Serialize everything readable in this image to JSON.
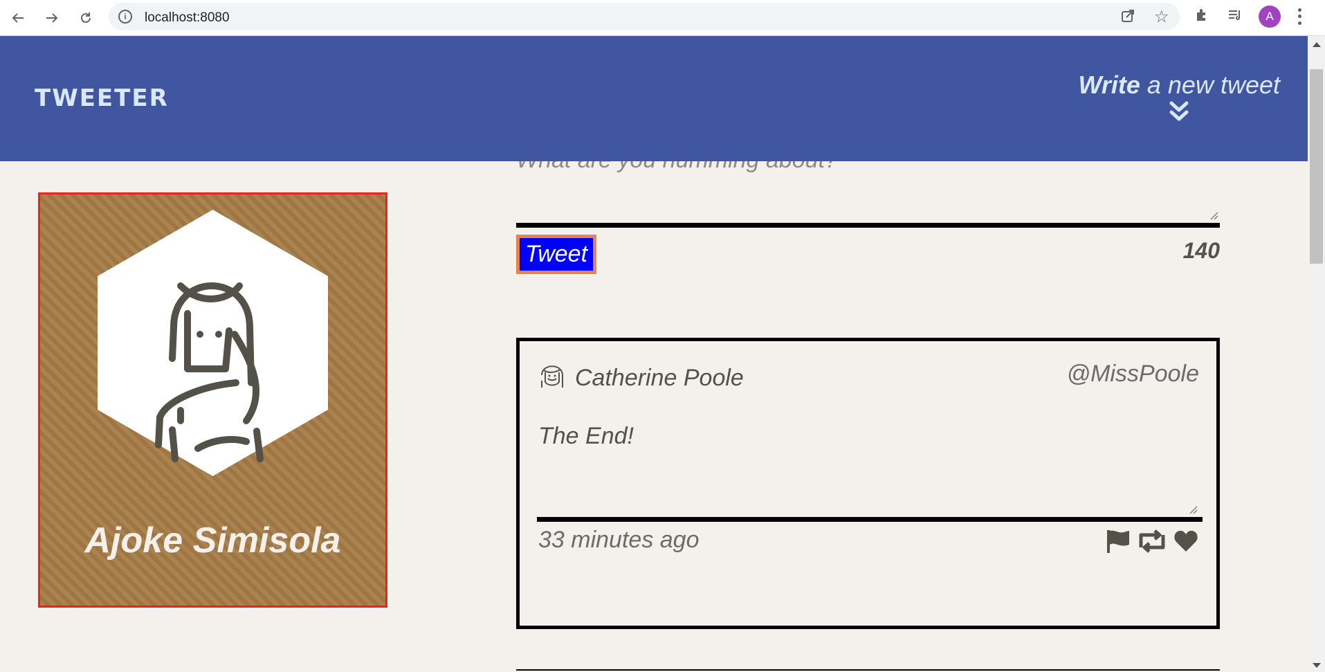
{
  "browser": {
    "url": "localhost:8080",
    "profile_initial": "A"
  },
  "header": {
    "brand": "TWEETER",
    "compose_bold": "Write",
    "compose_rest": " a new tweet"
  },
  "profile": {
    "name": "Ajoke Simisola"
  },
  "compose": {
    "placeholder": "What are you humming about?",
    "button_label": "Tweet",
    "counter": "140"
  },
  "tweets": [
    {
      "name": "Catherine Poole",
      "handle": "@MissPoole",
      "content": "The End!",
      "time": "33 minutes ago"
    }
  ],
  "colors": {
    "header_bg": "#4056a1",
    "header_text": "#dbe8f7",
    "page_bg": "#f4f1ec",
    "profile_bg": "#a57b45",
    "profile_border": "#e8241b",
    "button_bg": "#0000ff",
    "button_outline": "#e8824f",
    "text_muted": "#545149"
  }
}
